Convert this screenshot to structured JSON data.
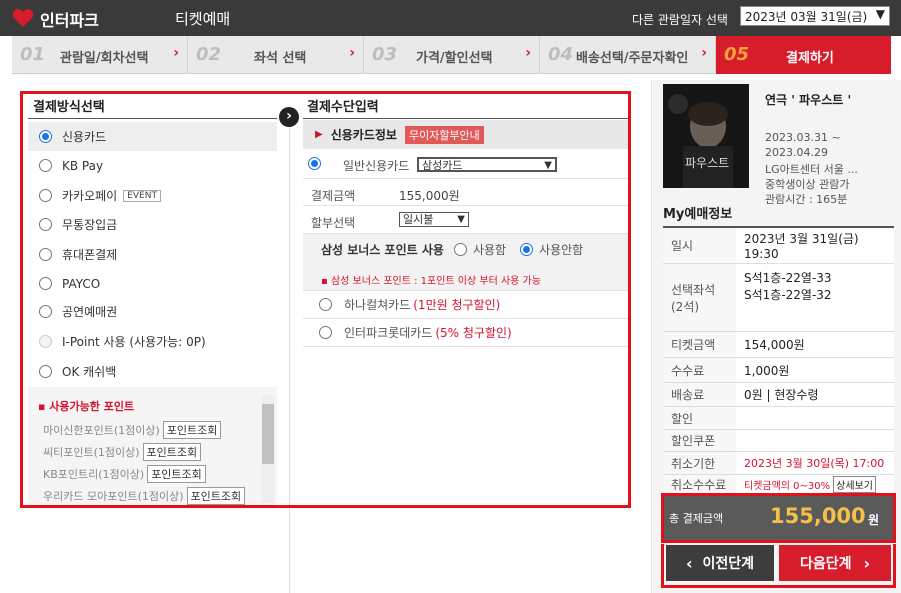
{
  "header": {
    "logo_text": "인터파크",
    "logo_sub": "티켓예매",
    "date_label": "다른 관람일자 선택",
    "date_value": "2023년 03월 31일(금)"
  },
  "steps": [
    {
      "num": "01",
      "label": "관람일/회차선택"
    },
    {
      "num": "02",
      "label": "좌석 선택"
    },
    {
      "num": "03",
      "label": "가격/할인선택"
    },
    {
      "num": "04",
      "label": "배송선택/주문자확인"
    },
    {
      "num": "05",
      "label": "결제하기"
    }
  ],
  "payment_methods": {
    "title": "결제방식선택",
    "items": [
      {
        "label": "신용카드",
        "selected": true
      },
      {
        "label": "KB Pay"
      },
      {
        "label": "카카오페이",
        "badge": "EVENT"
      },
      {
        "label": "무통장입금"
      },
      {
        "label": "휴대폰결제"
      },
      {
        "label": "PAYCO"
      },
      {
        "label": "공연예매권"
      },
      {
        "label": "I-Point 사용 (사용가능: 0P)",
        "disabled": true
      },
      {
        "label": "OK 캐쉬백"
      }
    ],
    "points": {
      "title": "사용가능한 포인트",
      "button_label": "포인트조회",
      "rows": [
        "마이신한포인트(1점이상)",
        "씨티포인트(1점이상)",
        "KB포인트리(1점이상)",
        "우리카드 모아포인트(1점이상)"
      ]
    }
  },
  "payment_input": {
    "title": "결제수단입력",
    "cc_title": "신용카드정보",
    "cc_badge": "무이자할부안내",
    "general_card_label": "일반신용카드",
    "card_select": "삼성카드",
    "amount_label": "결제금액",
    "amount_value": "155,000원",
    "installment_label": "할부선택",
    "installment_select": "일시불",
    "bonus_label": "삼성 보너스 포인트 사용",
    "bonus_use": "사용함",
    "bonus_nouse": "사용안함",
    "bonus_note": "삼성 보너스 포인트 : 1포인트 이상 부터 사용 가능",
    "card_options": [
      {
        "name": "하나컬쳐카드",
        "discount": "(1만원 청구할인)"
      },
      {
        "name": "인터파크롯데카드",
        "discount": "(5% 청구할인)"
      }
    ]
  },
  "show": {
    "title": "연극 ' 파우스트 '",
    "poster_text": "파우스트",
    "dates": [
      "2023.03.31 ~",
      "2023.04.29"
    ],
    "venue": "LG아트센터 서울 ...",
    "age": "중학생이상 관람가",
    "runtime": "관람시간 : 165분"
  },
  "my_booking": {
    "title": "My예매정보",
    "rows": [
      {
        "k": "일시",
        "v": [
          "2023년 3월 31일(금)",
          "19:30"
        ]
      },
      {
        "k": "선택좌석\n(2석)",
        "v": [
          "S석1층-22열-33",
          "S석1층-22열-32"
        ]
      },
      {
        "k": "티켓금액",
        "v": [
          "154,000원"
        ]
      },
      {
        "k": "수수료",
        "v": [
          "1,000원"
        ]
      },
      {
        "k": "배송료",
        "v": [
          "0원 | 현장수령"
        ]
      },
      {
        "k": "할인",
        "v": [
          ""
        ]
      },
      {
        "k": "할인쿠폰",
        "v": [
          ""
        ]
      },
      {
        "k": "취소기한",
        "v": [
          "2023년 3월 30일(목) 17:00"
        ]
      },
      {
        "k": "취소수수료",
        "v": [
          "티켓금액의 0~30%"
        ],
        "btn": "상세보기"
      }
    ]
  },
  "total": {
    "label": "총 결제금액",
    "amount": "155,000",
    "unit": "원"
  },
  "buttons": {
    "prev": "이전단계",
    "next": "다음단계"
  },
  "colors": {
    "brand_red": "#d71c2c",
    "accent_blue": "#1a73e8",
    "highlight_gold": "#f5c04a"
  }
}
